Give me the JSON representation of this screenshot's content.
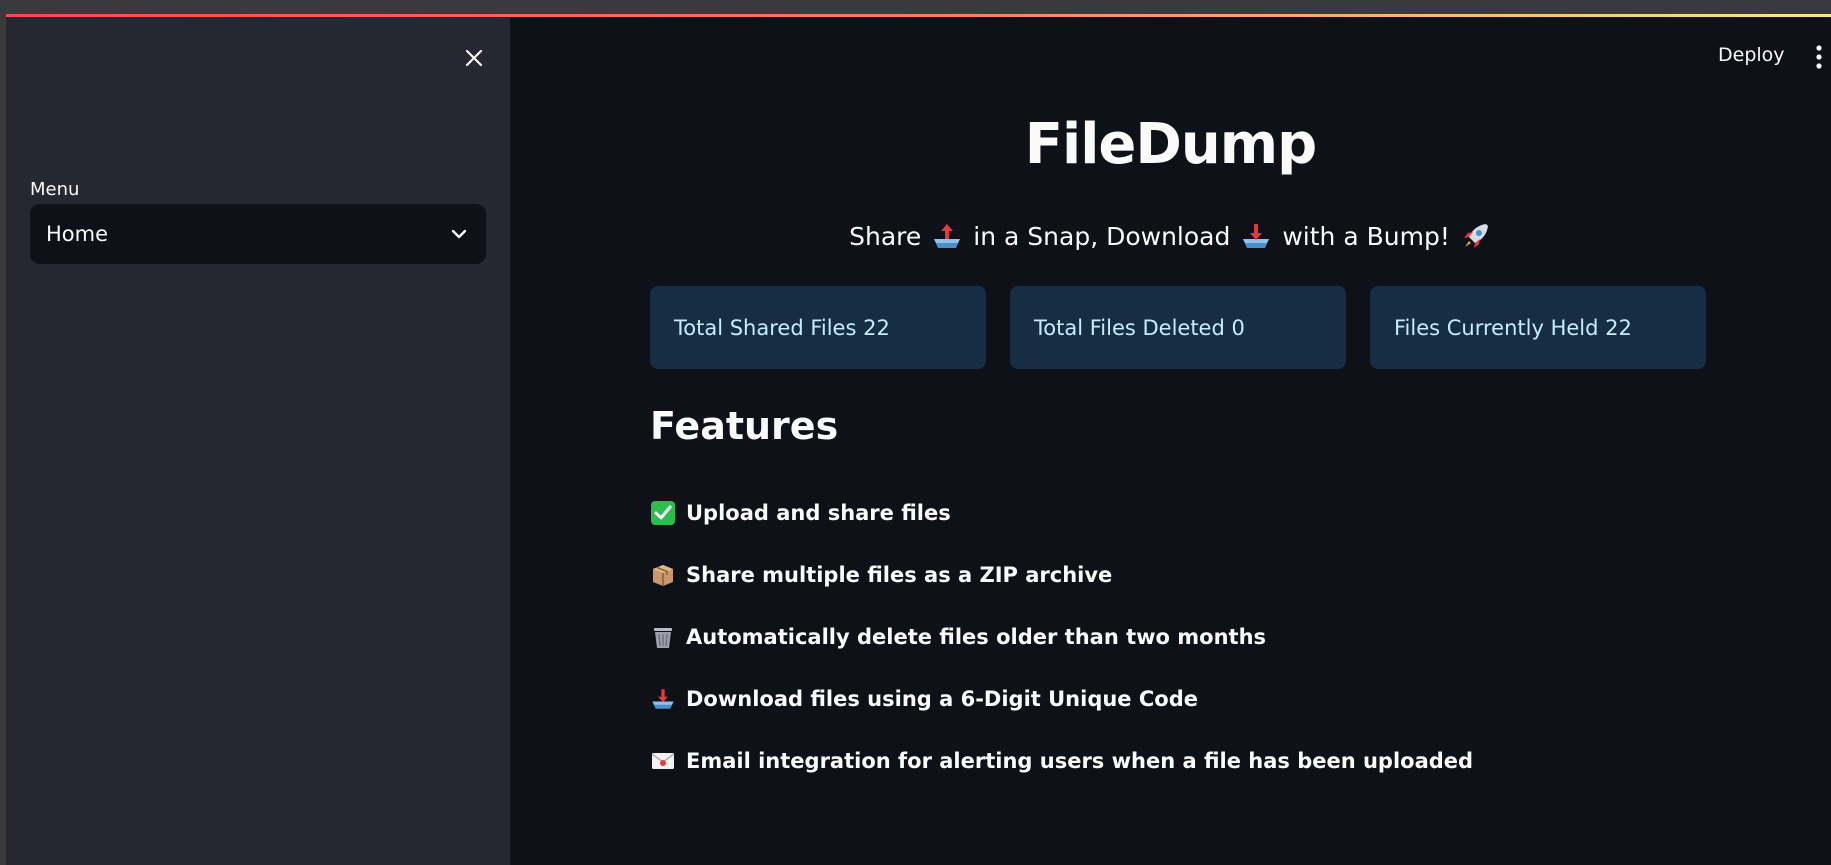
{
  "sidebar": {
    "menu_label": "Menu",
    "selected": "Home",
    "close_icon": "close-icon",
    "dropdown_icon": "chevron-down-icon"
  },
  "header": {
    "deploy_label": "Deploy",
    "menu_icon": "kebab-menu-icon",
    "accent_gradient": [
      "#ff4b4b",
      "#ffe97a"
    ]
  },
  "main": {
    "title": "FileDump",
    "subtitle": {
      "part1": "Share",
      "part2": "in a Snap, Download",
      "part3": "with a Bump!",
      "icons": [
        "upload-tray-icon",
        "download-tray-icon",
        "rocket-icon"
      ]
    },
    "stats": [
      {
        "label": "Total Shared Files 22"
      },
      {
        "label": "Total Files Deleted 0"
      },
      {
        "label": "Files Currently Held 22"
      }
    ],
    "features_heading": "Features",
    "features": [
      {
        "icon": "check-mark-icon",
        "text": "Upload and share files"
      },
      {
        "icon": "package-icon",
        "text": "Share multiple files as a ZIP archive"
      },
      {
        "icon": "wastebasket-icon",
        "text": "Automatically delete files older than two months"
      },
      {
        "icon": "download-tray-icon",
        "text": "Download files using a 6-Digit Unique Code"
      },
      {
        "icon": "envelope-icon",
        "text": "Email integration for alerting users when a file has been uploaded"
      }
    ]
  },
  "colors": {
    "background": "#0e1117",
    "sidebar": "#262730",
    "stat_card": "#172d43",
    "stat_text": "#c7ebff",
    "text": "#fafafa"
  }
}
